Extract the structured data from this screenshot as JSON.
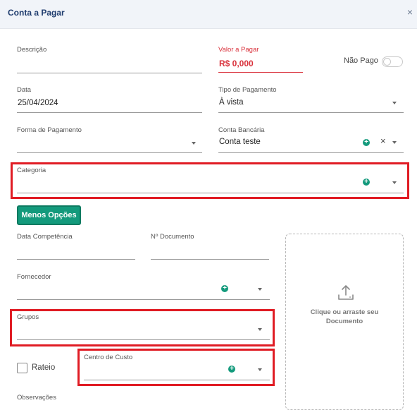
{
  "dialog": {
    "title": "Conta a Pagar",
    "close_glyph": "×"
  },
  "fields": {
    "descricao": {
      "label": "Descrição",
      "value": ""
    },
    "valor": {
      "label": "Valor a Pagar",
      "value": "R$ 0,000",
      "accent": "#d9303a"
    },
    "nao_pago": {
      "label": "Não Pago",
      "checked": false
    },
    "data": {
      "label": "Data",
      "value": "25/04/2024"
    },
    "tipo_pagamento": {
      "label": "Tipo de Pagamento",
      "value": "À vista"
    },
    "forma_pagamento": {
      "label": "Forma de Pagamento",
      "value": ""
    },
    "conta_bancaria": {
      "label": "Conta Bancária",
      "value": "Conta teste",
      "clear_glyph": "×"
    },
    "categoria": {
      "label": "Categoria",
      "value": ""
    },
    "data_competencia": {
      "label": "Data Competência",
      "value": ""
    },
    "n_documento": {
      "label": "Nº Documento",
      "value": ""
    },
    "fornecedor": {
      "label": "Fornecedor",
      "value": ""
    },
    "grupos": {
      "label": "Grupos",
      "value": ""
    },
    "centro_custo": {
      "label": "Centro de Custo",
      "value": ""
    },
    "rateio": {
      "label": "Rateio",
      "checked": false
    },
    "observacoes": {
      "label": "Observações"
    }
  },
  "buttons": {
    "menos_opcoes": "Menos Opções"
  },
  "upload": {
    "text": "Clique ou arraste seu Documento",
    "icon": "upload-icon"
  },
  "colors": {
    "primary": "#139a7c",
    "highlight": "#e01c24",
    "header_bg": "#f1f4f9",
    "title": "#1f3c6e"
  }
}
